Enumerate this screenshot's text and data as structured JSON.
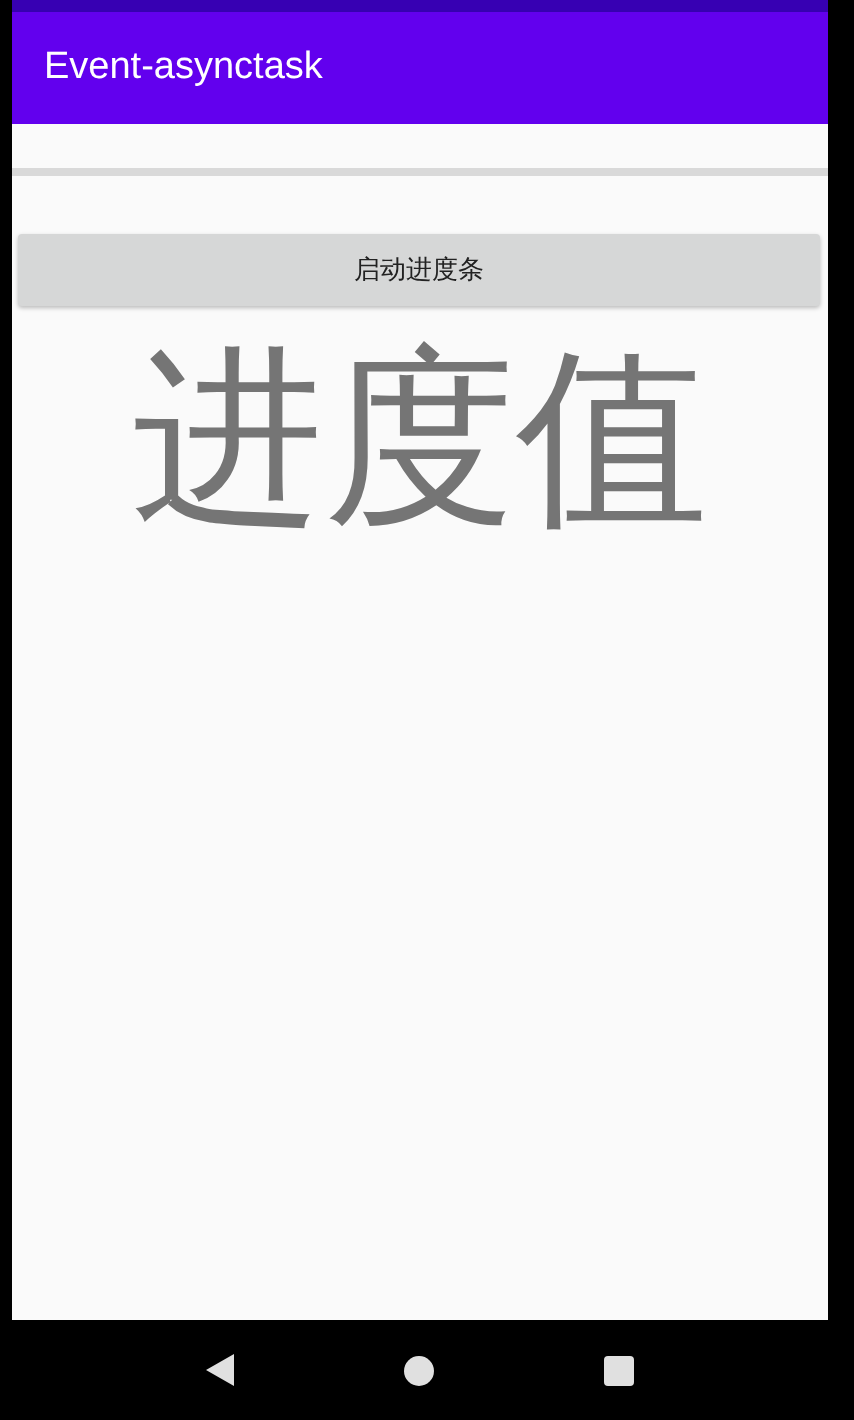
{
  "app_bar": {
    "title": "Event-asynctask"
  },
  "progress": {
    "level": 0
  },
  "start_button": {
    "label": "启动进度条"
  },
  "progress_value": {
    "text": "进度值"
  }
}
